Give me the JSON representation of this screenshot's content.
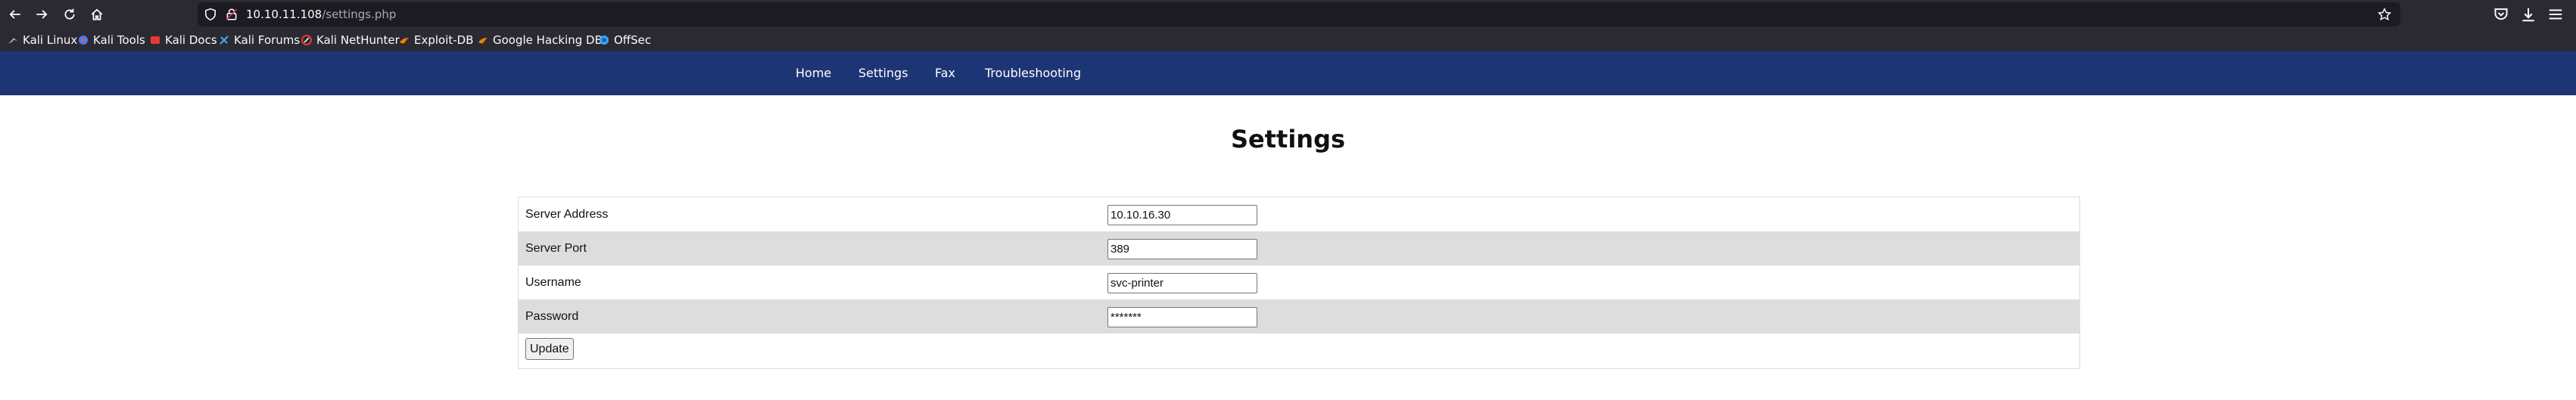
{
  "browser": {
    "url_host": "10.10.11.108",
    "url_path": "/settings.php",
    "icons": [
      "back-icon",
      "forward-icon",
      "reload-icon",
      "home-icon",
      "shield-icon",
      "lock-icon",
      "star-icon",
      "pocket-icon",
      "download-icon",
      "menu-icon"
    ]
  },
  "bookmarks": [
    {
      "label": "Kali Linux",
      "color": "#cfd8dc"
    },
    {
      "label": "Kali Tools",
      "color": "#3d7ff5"
    },
    {
      "label": "Kali Docs",
      "color": "#e53935"
    },
    {
      "label": "Kali Forums",
      "color": "#42a5f5"
    },
    {
      "label": "Kali NetHunter",
      "color": "#e53935"
    },
    {
      "label": "Exploit-DB",
      "color": "#f57c00"
    },
    {
      "label": "Google Hacking DB",
      "color": "#f57c00"
    },
    {
      "label": "OffSec",
      "color": "#42a5f5"
    }
  ],
  "site_nav": {
    "home": "Home",
    "settings": "Settings",
    "fax": "Fax",
    "troubleshooting": "Troubleshooting",
    "bg_color": "#1e3575"
  },
  "page": {
    "title": "Settings"
  },
  "form": {
    "server_address": {
      "label": "Server Address",
      "value": "10.10.16.30"
    },
    "server_port": {
      "label": "Server Port",
      "value": "389"
    },
    "username": {
      "label": "Username",
      "value": "svc-printer"
    },
    "password": {
      "label": "Password",
      "value": "*******"
    },
    "update_label": "Update"
  }
}
